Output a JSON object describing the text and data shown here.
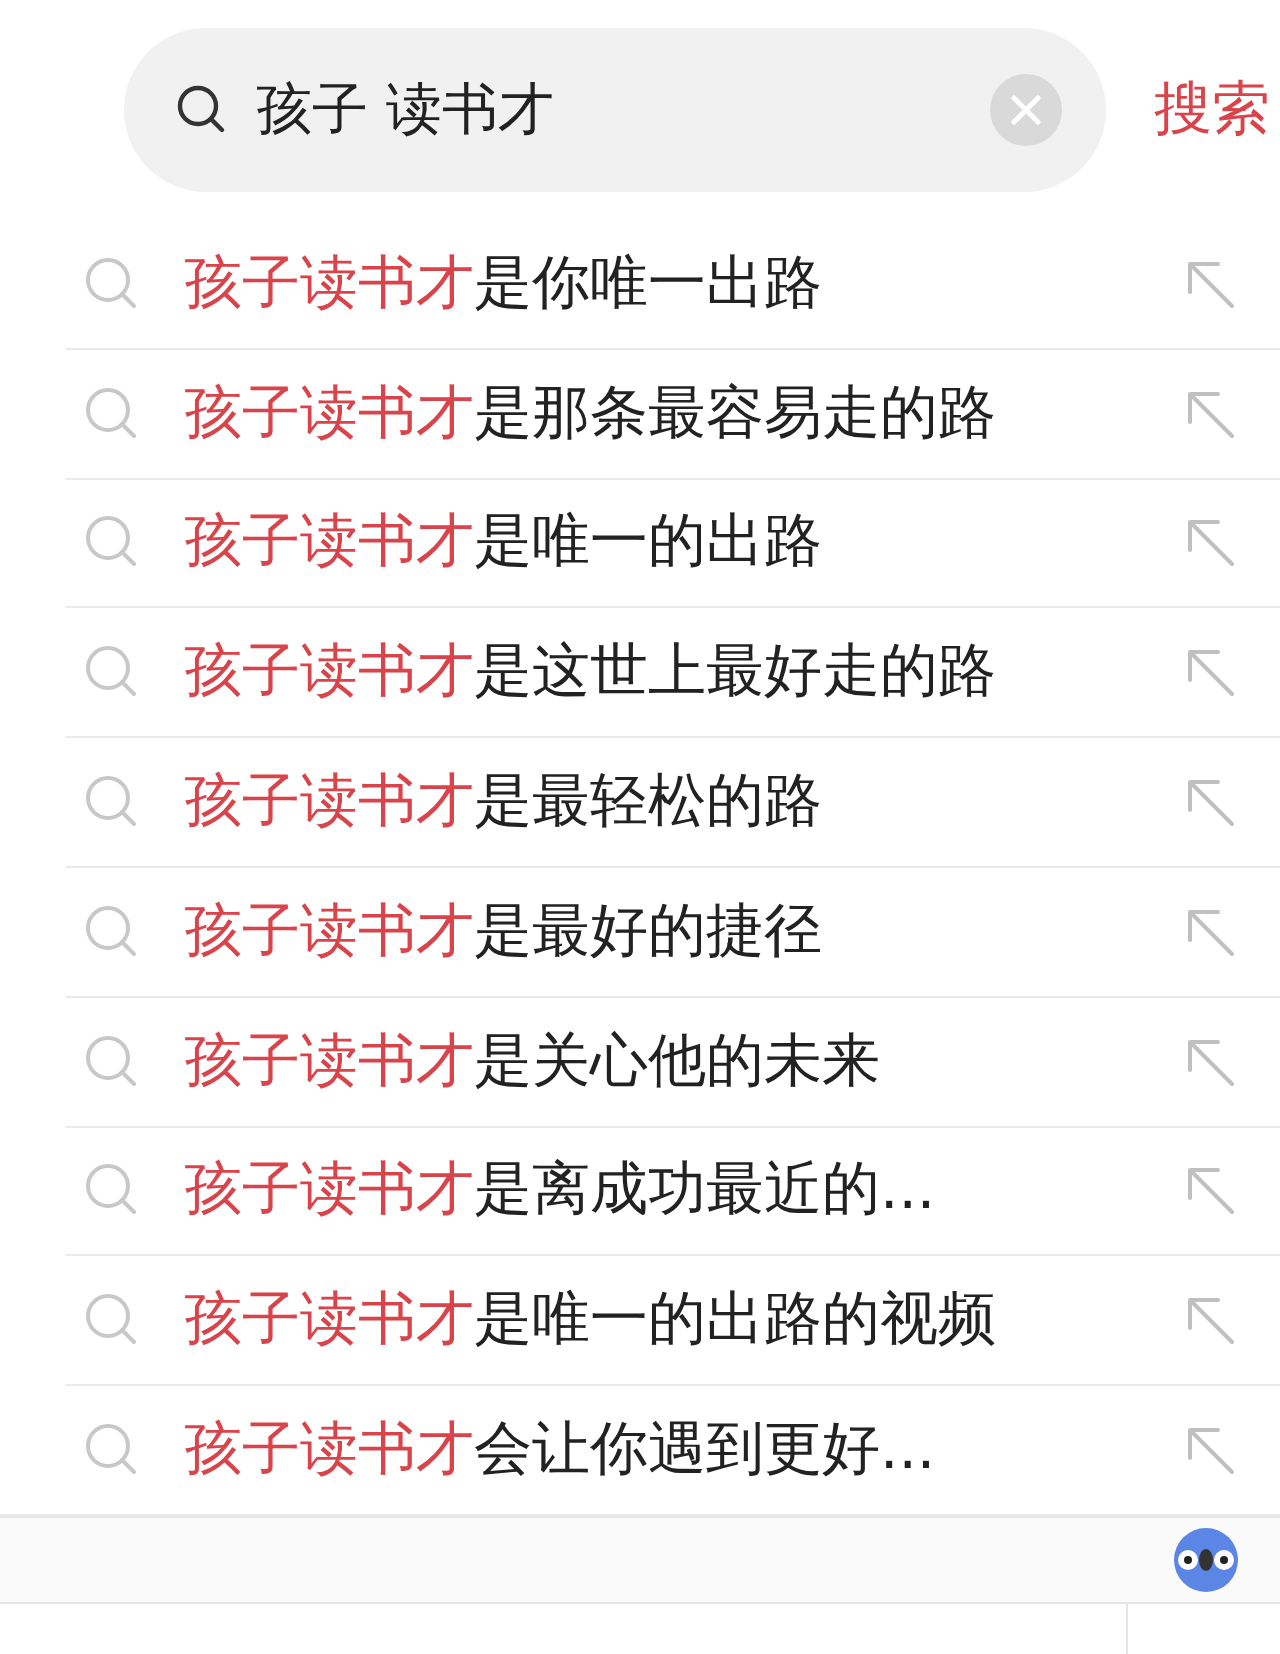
{
  "search": {
    "query": "孩子 读书才",
    "action": "搜索"
  },
  "suggestions": [
    {
      "match": "孩子读书才",
      "rest": "是你唯一出路"
    },
    {
      "match": "孩子读书才",
      "rest": "是那条最容易走的路"
    },
    {
      "match": "孩子读书才",
      "rest": "是唯一的出路"
    },
    {
      "match": "孩子读书才",
      "rest": "是这世上最好走的路"
    },
    {
      "match": "孩子读书才",
      "rest": "是最轻松的路"
    },
    {
      "match": "孩子读书才",
      "rest": "是最好的捷径"
    },
    {
      "match": "孩子读书才",
      "rest": "是关心他的未来"
    },
    {
      "match": "孩子读书才",
      "rest": "是离成功最近的..."
    },
    {
      "match": "孩子读书才",
      "rest": "是唯一的出路的视频"
    },
    {
      "match": "孩子读书才",
      "rest": "会让你遇到更好..."
    }
  ]
}
